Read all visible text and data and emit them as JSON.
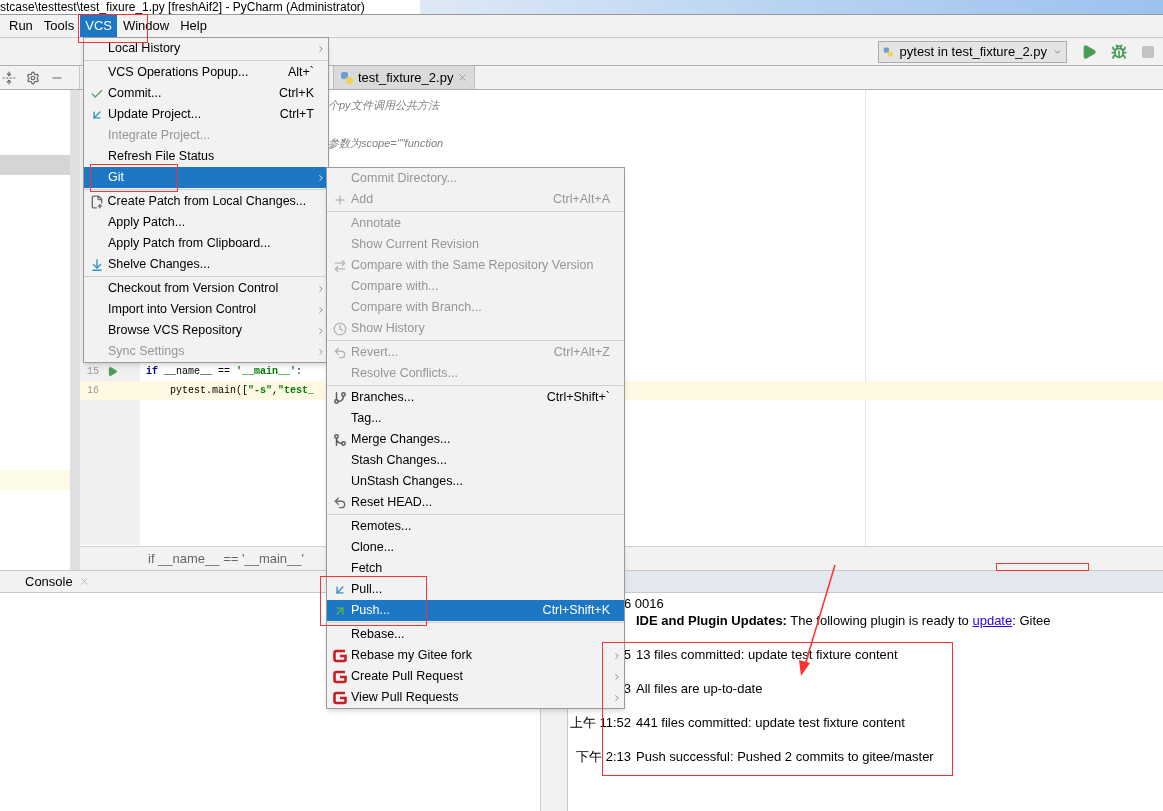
{
  "window": {
    "title": "stcase\\testtest\\test_fixure_1.py [freshAif2] - PyCharm (Administrator)"
  },
  "menu_bar": [
    {
      "label": "Run",
      "selected": false
    },
    {
      "label": "Tools",
      "selected": false
    },
    {
      "label": "VCS",
      "selected": true
    },
    {
      "label": "Window",
      "selected": false
    },
    {
      "label": "Help",
      "selected": false
    }
  ],
  "toolbar": {
    "run_config": "pytest in test_fixture_2.py"
  },
  "editor_tabs": [
    {
      "label": "test_fixture_2.py",
      "selected": true
    }
  ],
  "editor": {
    "comments": [
      "个py文件调用公共方法",
      "参数为scope=\"\"function"
    ],
    "lines": [
      {
        "number": "15",
        "run_marker": true,
        "current": false,
        "tokens": [
          {
            "kind": "keyword",
            "text": "if"
          },
          {
            "kind": "plain",
            "text": " __name__ == "
          },
          {
            "kind": "string",
            "text": "'__main__'"
          },
          {
            "kind": "plain",
            "text": ":"
          }
        ]
      },
      {
        "number": "16",
        "run_marker": false,
        "current": true,
        "tokens": [
          {
            "kind": "plain",
            "text": "    pytest.main(["
          },
          {
            "kind": "string",
            "text": "\"-s\""
          },
          {
            "kind": "plain",
            "text": ","
          },
          {
            "kind": "string",
            "text": "\"test_"
          }
        ]
      }
    ],
    "breadcrumb": "if __name__ == '__main__'"
  },
  "bottom_tabs": [
    {
      "label": "Console"
    }
  ],
  "event_log": {
    "date": "6 0016",
    "entries": [
      {
        "message": "**IDE and Plugin Updates:** The following plugin is ready to ",
        "link": "update",
        "message_after": ": Gitee"
      },
      {
        "time": "5",
        "message": "13 files committed: update test fixture content"
      },
      {
        "time": "3",
        "message": "All files are up-to-date"
      },
      {
        "time": "上午 11:52",
        "message": "441 files committed: update test fixture content"
      },
      {
        "time": "下午 2:13",
        "message": "Push successful: Pushed 2 commits to gitee/master"
      }
    ]
  },
  "vcs_menu": {
    "items": [
      {
        "kind": "item",
        "label": "Local History",
        "disabled": false,
        "selected": false,
        "submenu": true
      },
      {
        "kind": "separator"
      },
      {
        "kind": "item",
        "label": "VCS Operations Popup...",
        "shortcut": "Alt+`",
        "disabled": false,
        "selected": false,
        "submenu": false
      },
      {
        "kind": "check",
        "label": "Commit...",
        "shortcut": "Ctrl+K",
        "disabled": false,
        "selected": false,
        "submenu": false
      },
      {
        "kind": "pull",
        "label": "Update Project...",
        "shortcut": "Ctrl+T",
        "disabled": false,
        "selected": false,
        "submenu": false
      },
      {
        "kind": "item",
        "label": "Integrate Project...",
        "disabled": true,
        "selected": false,
        "submenu": false
      },
      {
        "kind": "item",
        "label": "Refresh File Status",
        "disabled": false,
        "selected": false,
        "submenu": false
      },
      {
        "kind": "item",
        "label": "Git",
        "disabled": false,
        "selected": true,
        "submenu": true
      },
      {
        "kind": "separator"
      },
      {
        "kind": "patch",
        "label": "Create Patch from Local Changes...",
        "disabled": false,
        "selected": false,
        "submenu": false
      },
      {
        "kind": "item",
        "label": "Apply Patch...",
        "disabled": false,
        "selected": false,
        "submenu": false
      },
      {
        "kind": "item",
        "label": "Apply Patch from Clipboard...",
        "disabled": false,
        "selected": false,
        "submenu": false
      },
      {
        "kind": "shelve",
        "label": "Shelve Changes...",
        "disabled": false,
        "selected": false,
        "submenu": false
      },
      {
        "kind": "separator"
      },
      {
        "kind": "item",
        "label": "Checkout from Version Control",
        "disabled": false,
        "selected": false,
        "submenu": true
      },
      {
        "kind": "item",
        "label": "Import into Version Control",
        "disabled": false,
        "selected": false,
        "submenu": true
      },
      {
        "kind": "item",
        "label": "Browse VCS Repository",
        "disabled": false,
        "selected": false,
        "submenu": true
      },
      {
        "kind": "item",
        "label": "Sync Settings",
        "disabled": true,
        "selected": false,
        "submenu": true
      }
    ]
  },
  "git_submenu": {
    "items": [
      {
        "kind": "item",
        "label": "Commit Directory...",
        "disabled": true,
        "selected": false,
        "submenu": false
      },
      {
        "kind": "plus",
        "label": "Add",
        "shortcut": "Ctrl+Alt+A",
        "disabled": true,
        "selected": false,
        "submenu": false
      },
      {
        "kind": "separator"
      },
      {
        "kind": "item",
        "label": "Annotate",
        "disabled": true,
        "selected": false,
        "submenu": false
      },
      {
        "kind": "item",
        "label": "Show Current Revision",
        "disabled": true,
        "selected": false,
        "submenu": false
      },
      {
        "kind": "compare",
        "label": "Compare with the Same Repository Version",
        "disabled": true,
        "selected": false,
        "submenu": false
      },
      {
        "kind": "item",
        "label": "Compare with...",
        "disabled": true,
        "selected": false,
        "submenu": false
      },
      {
        "kind": "item",
        "label": "Compare with Branch...",
        "disabled": true,
        "selected": false,
        "submenu": false
      },
      {
        "kind": "clock",
        "label": "Show History",
        "disabled": true,
        "selected": false,
        "submenu": false
      },
      {
        "kind": "separator"
      },
      {
        "kind": "undo",
        "label": "Revert...",
        "shortcut": "Ctrl+Alt+Z",
        "disabled": true,
        "selected": false,
        "submenu": false
      },
      {
        "kind": "item",
        "label": "Resolve Conflicts...",
        "disabled": true,
        "selected": false,
        "submenu": false
      },
      {
        "kind": "separator"
      },
      {
        "kind": "branch",
        "label": "Branches...",
        "shortcut": "Ctrl+Shift+`",
        "disabled": false,
        "selected": false,
        "submenu": false
      },
      {
        "kind": "item",
        "label": "Tag...",
        "disabled": false,
        "selected": false,
        "submenu": false
      },
      {
        "kind": "merge",
        "label": "Merge Changes...",
        "disabled": false,
        "selected": false,
        "submenu": false
      },
      {
        "kind": "item",
        "label": "Stash Changes...",
        "disabled": false,
        "selected": false,
        "submenu": false
      },
      {
        "kind": "item",
        "label": "UnStash Changes...",
        "disabled": false,
        "selected": false,
        "submenu": false
      },
      {
        "kind": "undo",
        "label": "Reset HEAD...",
        "disabled": false,
        "selected": false,
        "submenu": false
      },
      {
        "kind": "separator"
      },
      {
        "kind": "item",
        "label": "Remotes...",
        "disabled": false,
        "selected": false,
        "submenu": false
      },
      {
        "kind": "item",
        "label": "Clone...",
        "disabled": false,
        "selected": false,
        "submenu": false
      },
      {
        "kind": "item",
        "label": "Fetch",
        "disabled": false,
        "selected": false,
        "submenu": false
      },
      {
        "kind": "pull",
        "label": "Pull...",
        "disabled": false,
        "selected": false,
        "submenu": false
      },
      {
        "kind": "push",
        "label": "Push...",
        "shortcut": "Ctrl+Shift+K",
        "disabled": false,
        "selected": true,
        "submenu": false
      },
      {
        "kind": "separator"
      },
      {
        "kind": "item",
        "label": "Rebase...",
        "disabled": false,
        "selected": false,
        "submenu": false
      },
      {
        "kind": "logo",
        "label": "Rebase my Gitee fork",
        "disabled": false,
        "selected": false,
        "submenu": true
      },
      {
        "kind": "logo",
        "label": "Create Pull Request",
        "disabled": false,
        "selected": false,
        "submenu": true
      },
      {
        "kind": "logo",
        "label": "View Pull Requests",
        "disabled": false,
        "selected": false,
        "submenu": true
      }
    ]
  }
}
